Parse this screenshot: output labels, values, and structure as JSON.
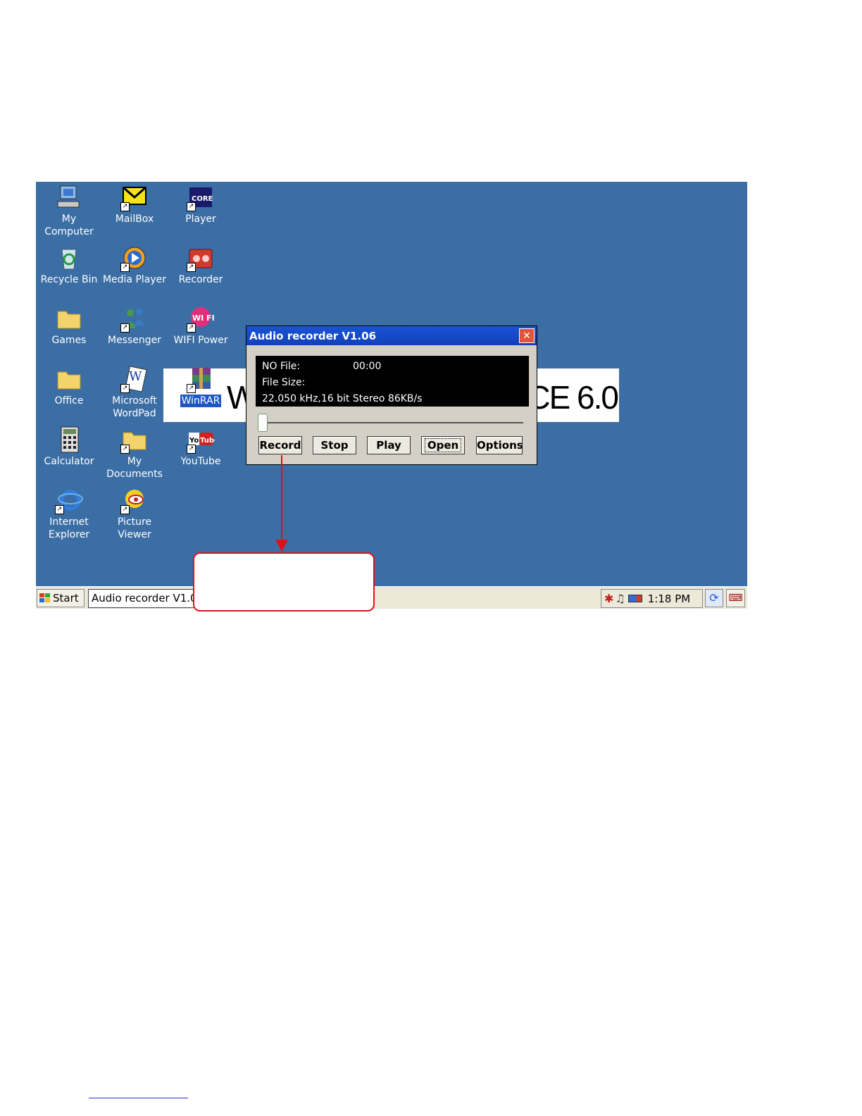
{
  "desktop": {
    "icons": [
      {
        "label": "My\nComputer",
        "icon": "my-computer-icon"
      },
      {
        "label": "MailBox",
        "icon": "mailbox-icon"
      },
      {
        "label": "Player",
        "icon": "coreplayer-icon"
      },
      {
        "label": "Recycle Bin",
        "icon": "recycle-bin-icon"
      },
      {
        "label": "Media Player",
        "icon": "media-player-icon"
      },
      {
        "label": "Recorder",
        "icon": "recorder-icon"
      },
      {
        "label": "Games",
        "icon": "folder-icon"
      },
      {
        "label": "Messenger",
        "icon": "messenger-icon"
      },
      {
        "label": "WIFI Power",
        "icon": "wifi-icon"
      },
      {
        "label": "Office",
        "icon": "folder-icon"
      },
      {
        "label": "Microsoft\nWordPad",
        "icon": "wordpad-icon"
      },
      {
        "label": "WinRAR",
        "icon": "winrar-icon"
      },
      {
        "label": "Calculator",
        "icon": "calculator-icon"
      },
      {
        "label": "My\nDocuments",
        "icon": "folder-icon"
      },
      {
        "label": "YouTube",
        "icon": "youtube-icon"
      },
      {
        "label": "Internet\nExplorer",
        "icon": "internet-explorer-icon"
      },
      {
        "label": "Picture\nViewer",
        "icon": "picture-viewer-icon"
      }
    ],
    "banner_left": "W",
    "banner_right": "CE 6.0"
  },
  "dialog": {
    "title": "Audio recorder V1.06",
    "close_label": "✕",
    "file_label": "NO File:",
    "time": "00:00",
    "size_label": "File Size:",
    "format": "22.050 kHz,16 bit Stereo 86KB/s",
    "progress": 0,
    "buttons": {
      "record": "Record",
      "stop": "Stop",
      "play": "Play",
      "open": "Open",
      "options": "Options"
    }
  },
  "taskbar": {
    "start_label": "Start",
    "task_label": "Audio recorder V1.06",
    "clock": "1:18 PM"
  },
  "colors": {
    "desktop": "#3b6ea5",
    "titlebar": "#1a54d6",
    "callout": "#e0101a"
  }
}
